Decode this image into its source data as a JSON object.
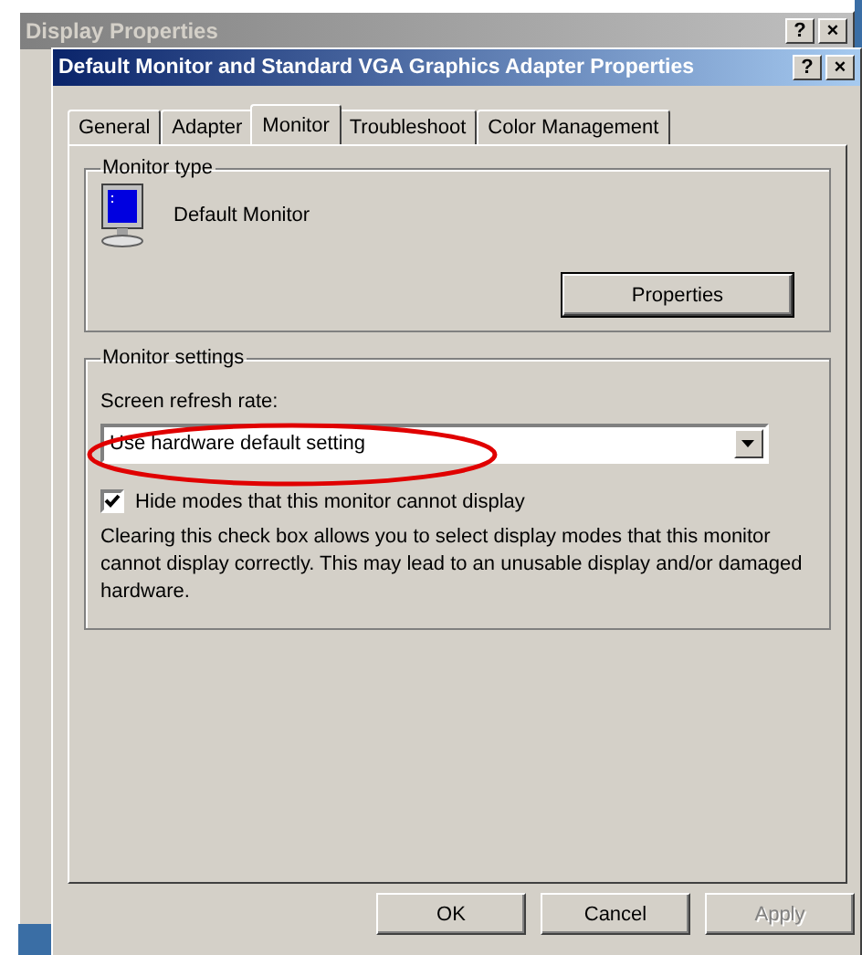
{
  "background_window": {
    "title": "Display Properties",
    "title_buttons": [
      "?",
      "×"
    ]
  },
  "window": {
    "title": "Default Monitor and Standard VGA Graphics Adapter Properties",
    "title_buttons": [
      "?",
      "×"
    ]
  },
  "tabs": [
    {
      "label": "General",
      "selected": false
    },
    {
      "label": "Adapter",
      "selected": false
    },
    {
      "label": "Monitor",
      "selected": true
    },
    {
      "label": "Troubleshoot",
      "selected": false
    },
    {
      "label": "Color Management",
      "selected": false
    }
  ],
  "monitor_type": {
    "heading": "Monitor type",
    "name": "Default Monitor",
    "button": "Properties"
  },
  "monitor_settings": {
    "heading": "Monitor settings",
    "refresh_label": "Screen refresh rate:",
    "refresh_value": "Use hardware default setting",
    "refresh_highlighted": true,
    "hide_modes": {
      "label": "Hide modes that this monitor cannot display",
      "checked": true
    },
    "note": "Clearing this check box allows you to select display modes that this monitor cannot display correctly. This may lead to an unusable display and/or damaged hardware."
  },
  "buttons": [
    {
      "label": "OK",
      "disabled": false
    },
    {
      "label": "Cancel",
      "disabled": false
    },
    {
      "label": "Apply",
      "disabled": true
    }
  ]
}
